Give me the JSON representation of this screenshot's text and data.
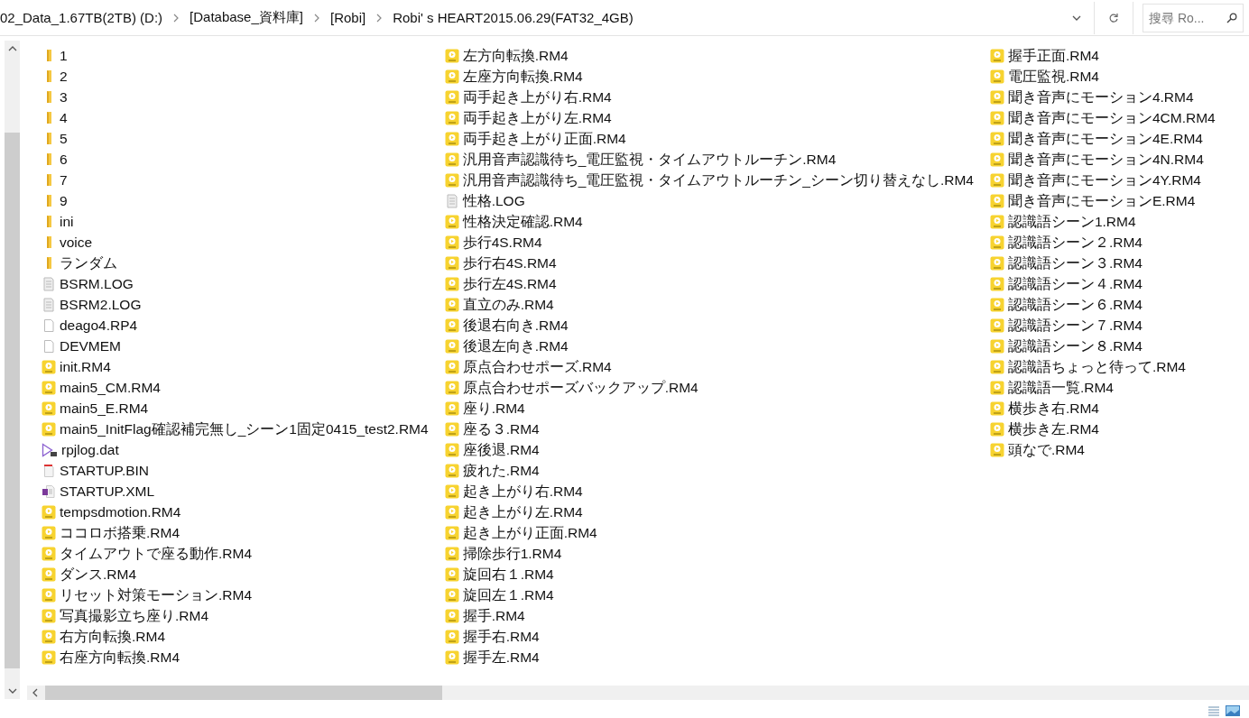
{
  "address_bar": {
    "breadcrumbs": [
      "02_Data_1.67TB(2TB) (D:)",
      "[Database_資料庫]",
      "[Robi]",
      "Robi' s HEART2015.06.29(FAT32_4GB)"
    ]
  },
  "search": {
    "placeholder": "搜尋 Ro..."
  },
  "files": [
    {
      "name": "1",
      "kind": "folder"
    },
    {
      "name": "2",
      "kind": "folder"
    },
    {
      "name": "3",
      "kind": "folder"
    },
    {
      "name": "4",
      "kind": "folder"
    },
    {
      "name": "5",
      "kind": "folder"
    },
    {
      "name": "6",
      "kind": "folder"
    },
    {
      "name": "7",
      "kind": "folder"
    },
    {
      "name": "9",
      "kind": "folder"
    },
    {
      "name": "ini",
      "kind": "folder"
    },
    {
      "name": "voice",
      "kind": "folder"
    },
    {
      "name": "ランダム",
      "kind": "folder"
    },
    {
      "name": "BSRM.LOG",
      "kind": "log"
    },
    {
      "name": "BSRM2.LOG",
      "kind": "log"
    },
    {
      "name": "deago4.RP4",
      "kind": "file"
    },
    {
      "name": "DEVMEM",
      "kind": "file"
    },
    {
      "name": "init.RM4",
      "kind": "rm4"
    },
    {
      "name": "main5_CM.RM4",
      "kind": "rm4"
    },
    {
      "name": "main5_E.RM4",
      "kind": "rm4"
    },
    {
      "name": "main5_InitFlag確認補完無し_シーン1固定0415_test2.RM4",
      "kind": "rm4"
    },
    {
      "name": "rpjlog.dat",
      "kind": "dat"
    },
    {
      "name": "STARTUP.BIN",
      "kind": "bin"
    },
    {
      "name": "STARTUP.XML",
      "kind": "xml"
    },
    {
      "name": "tempsdmotion.RM4",
      "kind": "rm4"
    },
    {
      "name": "ココロボ搭乗.RM4",
      "kind": "rm4"
    },
    {
      "name": "タイムアウトで座る動作.RM4",
      "kind": "rm4"
    },
    {
      "name": "ダンス.RM4",
      "kind": "rm4"
    },
    {
      "name": "リセット対策モーション.RM4",
      "kind": "rm4"
    },
    {
      "name": "写真撮影立ち座り.RM4",
      "kind": "rm4"
    },
    {
      "name": "右方向転換.RM4",
      "kind": "rm4"
    },
    {
      "name": "右座方向転換.RM4",
      "kind": "rm4"
    },
    {
      "name": "左方向転換.RM4",
      "kind": "rm4"
    },
    {
      "name": "左座方向転換.RM4",
      "kind": "rm4"
    },
    {
      "name": "両手起き上がり右.RM4",
      "kind": "rm4"
    },
    {
      "name": "両手起き上がり左.RM4",
      "kind": "rm4"
    },
    {
      "name": "両手起き上がり正面.RM4",
      "kind": "rm4"
    },
    {
      "name": "汎用音声認識待ち_電圧監視・タイムアウトルーチン.RM4",
      "kind": "rm4"
    },
    {
      "name": "汎用音声認識待ち_電圧監視・タイムアウトルーチン_シーン切り替えなし.RM4",
      "kind": "rm4"
    },
    {
      "name": "性格.LOG",
      "kind": "log"
    },
    {
      "name": "性格決定確認.RM4",
      "kind": "rm4"
    },
    {
      "name": "歩行4S.RM4",
      "kind": "rm4"
    },
    {
      "name": "歩行右4S.RM4",
      "kind": "rm4"
    },
    {
      "name": "歩行左4S.RM4",
      "kind": "rm4"
    },
    {
      "name": "直立のみ.RM4",
      "kind": "rm4"
    },
    {
      "name": "後退右向き.RM4",
      "kind": "rm4"
    },
    {
      "name": "後退左向き.RM4",
      "kind": "rm4"
    },
    {
      "name": "原点合わせポーズ.RM4",
      "kind": "rm4"
    },
    {
      "name": "原点合わせポーズバックアップ.RM4",
      "kind": "rm4"
    },
    {
      "name": "座り.RM4",
      "kind": "rm4"
    },
    {
      "name": "座る３.RM4",
      "kind": "rm4"
    },
    {
      "name": "座後退.RM4",
      "kind": "rm4"
    },
    {
      "name": "疲れた.RM4",
      "kind": "rm4"
    },
    {
      "name": "起き上がり右.RM4",
      "kind": "rm4"
    },
    {
      "name": "起き上がり左.RM4",
      "kind": "rm4"
    },
    {
      "name": "起き上がり正面.RM4",
      "kind": "rm4"
    },
    {
      "name": "掃除歩行1.RM4",
      "kind": "rm4"
    },
    {
      "name": "旋回右１.RM4",
      "kind": "rm4"
    },
    {
      "name": "旋回左１.RM4",
      "kind": "rm4"
    },
    {
      "name": "握手.RM4",
      "kind": "rm4"
    },
    {
      "name": "握手右.RM4",
      "kind": "rm4"
    },
    {
      "name": "握手左.RM4",
      "kind": "rm4"
    },
    {
      "name": "握手正面.RM4",
      "kind": "rm4"
    },
    {
      "name": "電圧監視.RM4",
      "kind": "rm4"
    },
    {
      "name": "聞き音声にモーション4.RM4",
      "kind": "rm4"
    },
    {
      "name": "聞き音声にモーション4CM.RM4",
      "kind": "rm4"
    },
    {
      "name": "聞き音声にモーション4E.RM4",
      "kind": "rm4"
    },
    {
      "name": "聞き音声にモーション4N.RM4",
      "kind": "rm4"
    },
    {
      "name": "聞き音声にモーション4Y.RM4",
      "kind": "rm4"
    },
    {
      "name": "聞き音声にモーションE.RM4",
      "kind": "rm4"
    },
    {
      "name": "認識語シーン1.RM4",
      "kind": "rm4"
    },
    {
      "name": "認識語シーン２.RM4",
      "kind": "rm4"
    },
    {
      "name": "認識語シーン３.RM4",
      "kind": "rm4"
    },
    {
      "name": "認識語シーン４.RM4",
      "kind": "rm4"
    },
    {
      "name": "認識語シーン６.RM4",
      "kind": "rm4"
    },
    {
      "name": "認識語シーン７.RM4",
      "kind": "rm4"
    },
    {
      "name": "認識語シーン８.RM4",
      "kind": "rm4"
    },
    {
      "name": "認識語ちょっと待って.RM4",
      "kind": "rm4"
    },
    {
      "name": "認識語一覧.RM4",
      "kind": "rm4"
    },
    {
      "name": "横歩き右.RM4",
      "kind": "rm4"
    },
    {
      "name": "横歩き左.RM4",
      "kind": "rm4"
    },
    {
      "name": "頭なで.RM4",
      "kind": "rm4"
    }
  ]
}
